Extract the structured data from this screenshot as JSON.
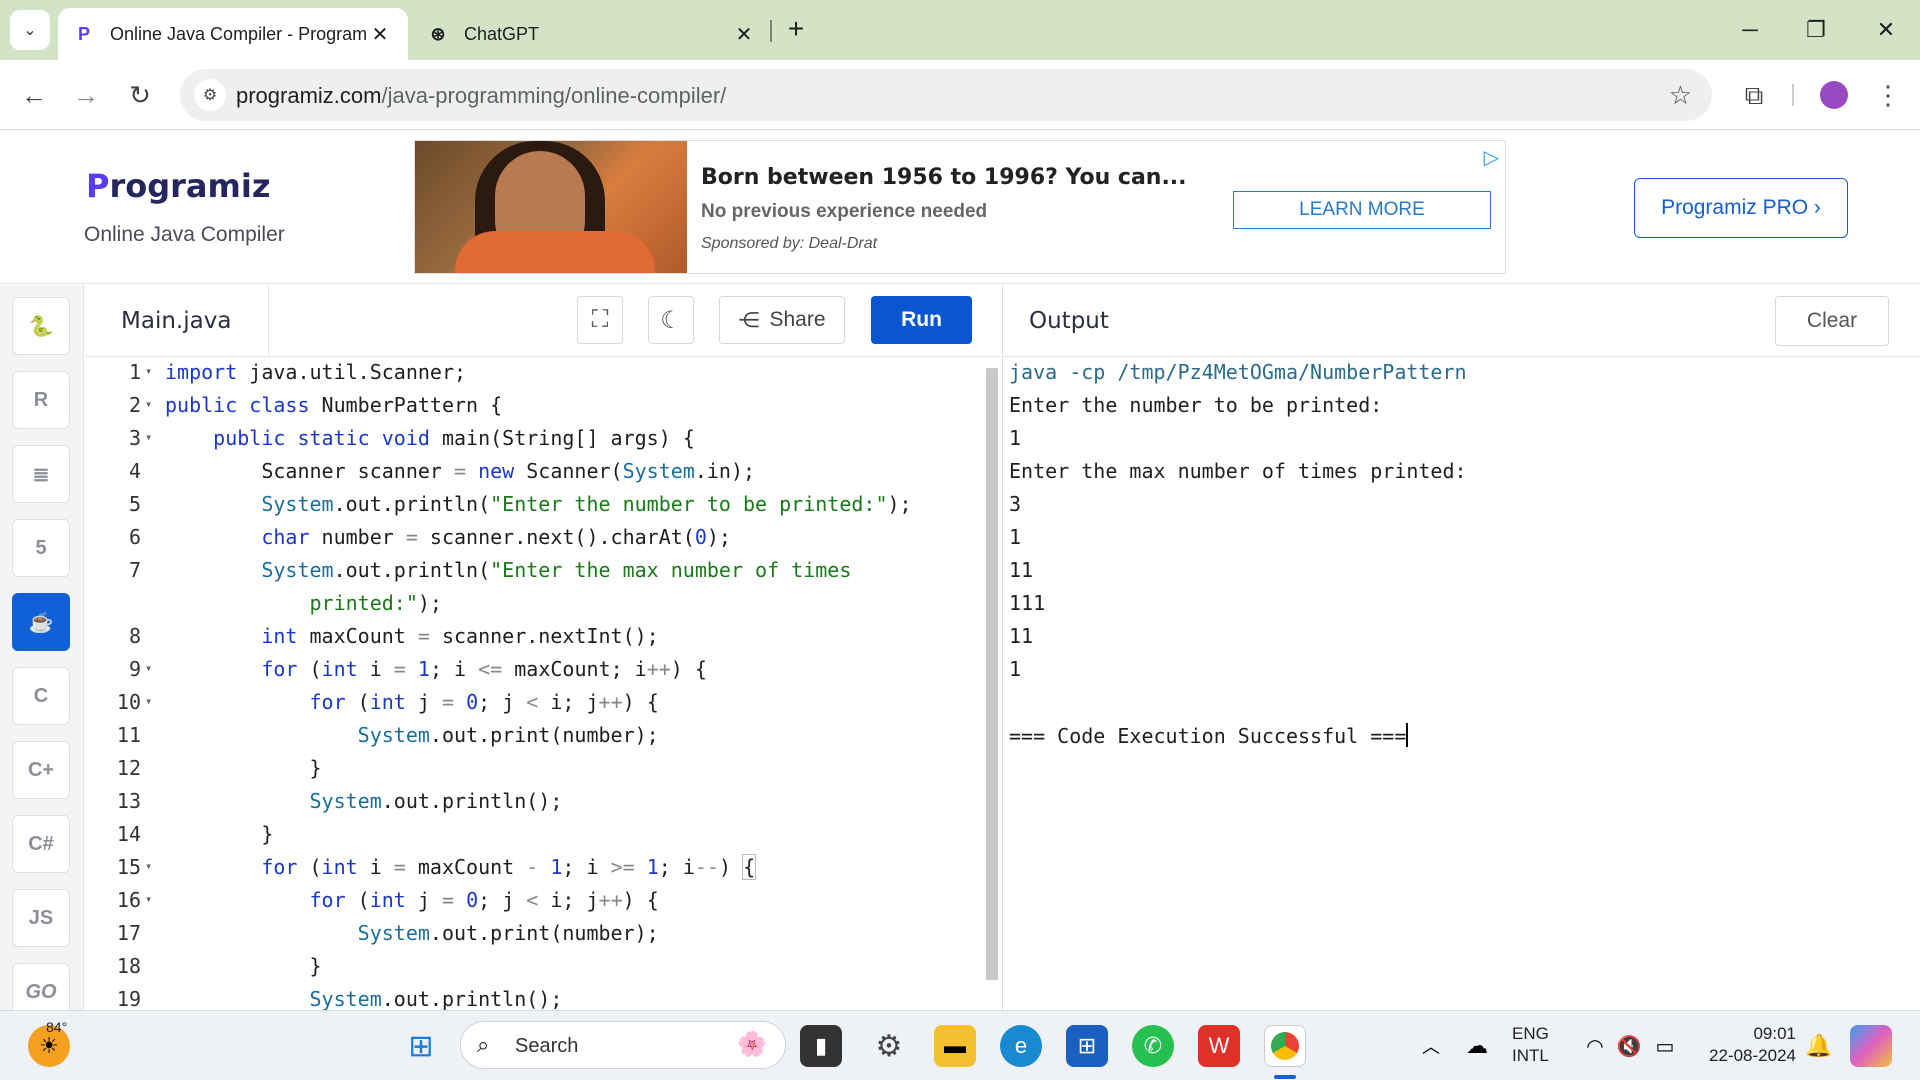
{
  "browser": {
    "tabs": [
      {
        "title": "Online Java Compiler - Program",
        "favicon": "P",
        "active": true
      },
      {
        "title": "ChatGPT",
        "favicon": "⊛",
        "active": false
      }
    ],
    "url_host": "programiz.com",
    "url_path": "/java-programming/online-compiler/"
  },
  "site": {
    "logo": "rogramiz",
    "logo_p": "P",
    "subtitle": "Online Java Compiler",
    "pro_button": "Programiz PRO ›"
  },
  "ad": {
    "headline": "Born between 1956 to 1996? You can...",
    "sub": "No previous experience needed",
    "sponsor": "Sponsored by: Deal-Drat",
    "cta": "LEARN MORE"
  },
  "sidebar": {
    "languages": [
      "python",
      "r",
      "sql",
      "html",
      "java",
      "c",
      "cpp",
      "csharp",
      "js",
      "go"
    ],
    "labels": {
      "js": "JS",
      "go": "GO"
    }
  },
  "editor": {
    "filename": "Main.java",
    "share_label": "Share",
    "run_label": "Run"
  },
  "output_panel": {
    "title": "Output",
    "clear_label": "Clear",
    "lines": [
      "java -cp /tmp/Pz4MetOGma/NumberPattern",
      "Enter the number to be printed:",
      "1",
      "Enter the max number of times printed:",
      "3",
      "1",
      "11",
      "111",
      "11",
      "1",
      "",
      "=== Code Execution Successful ==="
    ]
  },
  "code": {
    "line_numbers": [
      "1",
      "2",
      "3",
      "4",
      "5",
      "6",
      "7",
      "",
      "8",
      "9",
      "10",
      "11",
      "12",
      "13",
      "14",
      "15",
      "16",
      "17",
      "18",
      "19"
    ]
  },
  "taskbar": {
    "weather": "84°",
    "search_label": "Search",
    "lang_top": "ENG",
    "lang_bottom": "INTL",
    "time": "09:01",
    "date": "22-08-2024"
  }
}
